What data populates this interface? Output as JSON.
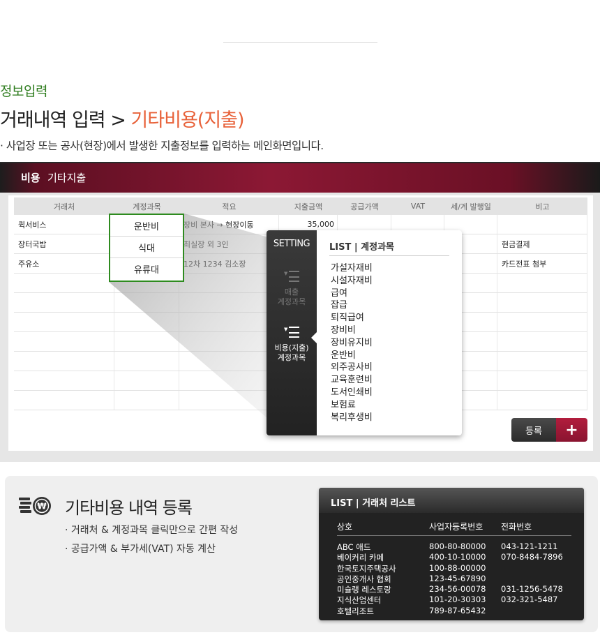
{
  "page": {
    "section_label": "정보입력",
    "title_prefix": "거래내역 입력 >",
    "title_accent": "기타비용(지출)",
    "description": "· 사업장 또는 공사(현장)에서 발생한 지출정보를 입력하는 메인화면입니다."
  },
  "app": {
    "header_bold": "비용",
    "header_text": "기타지출",
    "columns": [
      "거래처",
      "계정과목",
      "적요",
      "지출금액",
      "공급가액",
      "VAT",
      "세/계 발행일",
      "비고"
    ],
    "rows": [
      [
        "퀵서비스",
        "운반비",
        "장비 본사 → 현장이동",
        "35,000",
        "",
        "",
        "",
        ""
      ],
      [
        "장터국밥",
        "식대",
        "최실장 외 3인",
        "",
        "",
        "",
        "",
        "현금결제"
      ],
      [
        "주유소",
        "유류대",
        "12차 1234 김소장",
        "",
        "",
        "",
        "",
        "카드전표 첨부"
      ],
      [
        "",
        "",
        "",
        "",
        "",
        "",
        "",
        ""
      ],
      [
        "",
        "",
        "",
        "",
        "",
        "",
        "",
        ""
      ],
      [
        "",
        "",
        "",
        "",
        "",
        "",
        "",
        ""
      ],
      [
        "",
        "",
        "",
        "",
        "",
        "",
        "",
        ""
      ],
      [
        "",
        "",
        "",
        "",
        "",
        "",
        "",
        ""
      ],
      [
        "",
        "",
        "",
        "",
        "",
        "",
        "",
        ""
      ],
      [
        "",
        "",
        "",
        "",
        "",
        "",
        "",
        ""
      ]
    ],
    "register_label": "등록",
    "register_plus": "+"
  },
  "popup": {
    "setting_label": "SETTING",
    "side_items": [
      {
        "line1": "매출",
        "line2": "계정과목",
        "active": false
      },
      {
        "line1": "비용(지출)",
        "line2": "계정과목",
        "active": true
      }
    ],
    "list_title": "LIST  |  계정과목",
    "accounts": [
      "가설자재비",
      "시설자재비",
      "급여",
      "잡급",
      "퇴직급여",
      "장비비",
      "장비유지비",
      "운반비",
      "외주공사비",
      "교육훈련비",
      "도서인쇄비",
      "보험료",
      "복리후생비"
    ]
  },
  "bottom": {
    "title": "기타비용 내역 등록",
    "features": [
      "· 거래처 & 계정과목 클릭만으로 간편 작성",
      "· 공급가액 & 부가세(VAT) 자동 계산"
    ],
    "vendor_title": "LIST  |  거래처 리스트",
    "vendor_columns": [
      "상호",
      "사업자등록번호",
      "전화번호"
    ],
    "vendors": [
      [
        "ABC 애드",
        "800-80-80000",
        "043-121-1211"
      ],
      [
        "베이커리 카페",
        "400-10-10000",
        "070-8484-7896"
      ],
      [
        "한국토지주택공사",
        "100-88-00000",
        ""
      ],
      [
        "공인중개사 협회",
        "123-45-67890",
        ""
      ],
      [
        "미슐랭 레스토랑",
        "234-56-00078",
        "031-1256-5478"
      ],
      [
        "지식산업센터",
        "101-20-30303",
        "032-321-5487"
      ],
      [
        "호텔리조트",
        "789-87-65432",
        ""
      ]
    ]
  },
  "icons": {
    "coin": "coin-stack-icon",
    "menu": "menu-list-icon",
    "plus": "plus-icon"
  },
  "colors": {
    "accent_green": "#2f7d1f",
    "accent_orange": "#e8623a",
    "header_crimson": "#8c1834",
    "dark": "#222222"
  }
}
